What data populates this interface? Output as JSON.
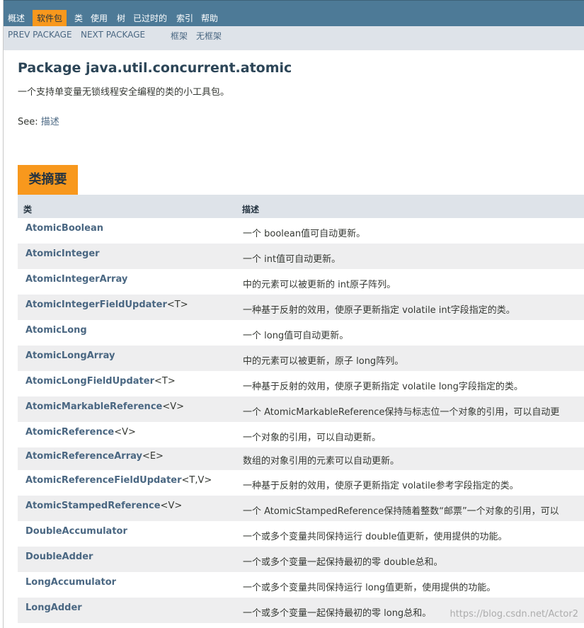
{
  "nav": {
    "items": [
      "概述",
      "软件包",
      "类",
      "使用",
      "树",
      "已过时的",
      "索引",
      "帮助"
    ],
    "active_index": 1
  },
  "subnav": {
    "prev": "PREV PACKAGE",
    "next": "NEXT PACKAGE",
    "frames": "框架",
    "no_frames": "无框架"
  },
  "page": {
    "title": "Package java.util.concurrent.atomic",
    "description": "一个支持单变量无锁线程安全编程的类的小工具包。",
    "see_label": "See:",
    "see_link": "描述"
  },
  "summary": {
    "caption": "类摘要",
    "col_class": "类",
    "col_desc": "描述",
    "rows": [
      {
        "name": "AtomicBoolean",
        "type_params": "",
        "desc": "一个 boolean值可自动更新。"
      },
      {
        "name": "AtomicInteger",
        "type_params": "",
        "desc": "一个 int值可自动更新。"
      },
      {
        "name": "AtomicIntegerArray",
        "type_params": "",
        "desc": "中的元素可以被更新的 int原子阵列。"
      },
      {
        "name": "AtomicIntegerFieldUpdater",
        "type_params": "<T>",
        "desc": "一种基于反射的效用，使原子更新指定 volatile int字段指定的类。"
      },
      {
        "name": "AtomicLong",
        "type_params": "",
        "desc": "一个 long值可自动更新。"
      },
      {
        "name": "AtomicLongArray",
        "type_params": "",
        "desc": "中的元素可以被更新，原子 long阵列。"
      },
      {
        "name": "AtomicLongFieldUpdater",
        "type_params": "<T>",
        "desc": "一种基于反射的效用，使原子更新指定 volatile long字段指定的类。"
      },
      {
        "name": "AtomicMarkableReference",
        "type_params": "<V>",
        "desc": "一个 AtomicMarkableReference保持与标志位一个对象的引用，可以自动更"
      },
      {
        "name": "AtomicReference",
        "type_params": "<V>",
        "desc": "一个对象的引用，可以自动更新。"
      },
      {
        "name": "AtomicReferenceArray",
        "type_params": "<E>",
        "desc": "数组的对象引用的元素可以自动更新。"
      },
      {
        "name": "AtomicReferenceFieldUpdater",
        "type_params": "<T,V>",
        "desc": "一种基于反射的效用，使原子更新指定 volatile参考字段指定的类。"
      },
      {
        "name": "AtomicStampedReference",
        "type_params": "<V>",
        "desc": "一个 AtomicStampedReference保持随着整数“邮票”一个对象的引用，可以"
      },
      {
        "name": "DoubleAccumulator",
        "type_params": "",
        "desc": "一个或多个变量共同保持运行 double值更新，使用提供的功能。"
      },
      {
        "name": "DoubleAdder",
        "type_params": "",
        "desc": "一个或多个变量一起保持最初的零 double总和。"
      },
      {
        "name": "LongAccumulator",
        "type_params": "",
        "desc": "一个或多个变量共同保持运行 long值更新，使用提供的功能。"
      },
      {
        "name": "LongAdder",
        "type_params": "",
        "desc": "一个或多个变量一起保持最初的零 long总和。"
      }
    ]
  },
  "watermark": "https://blog.csdn.net/Actor2"
}
